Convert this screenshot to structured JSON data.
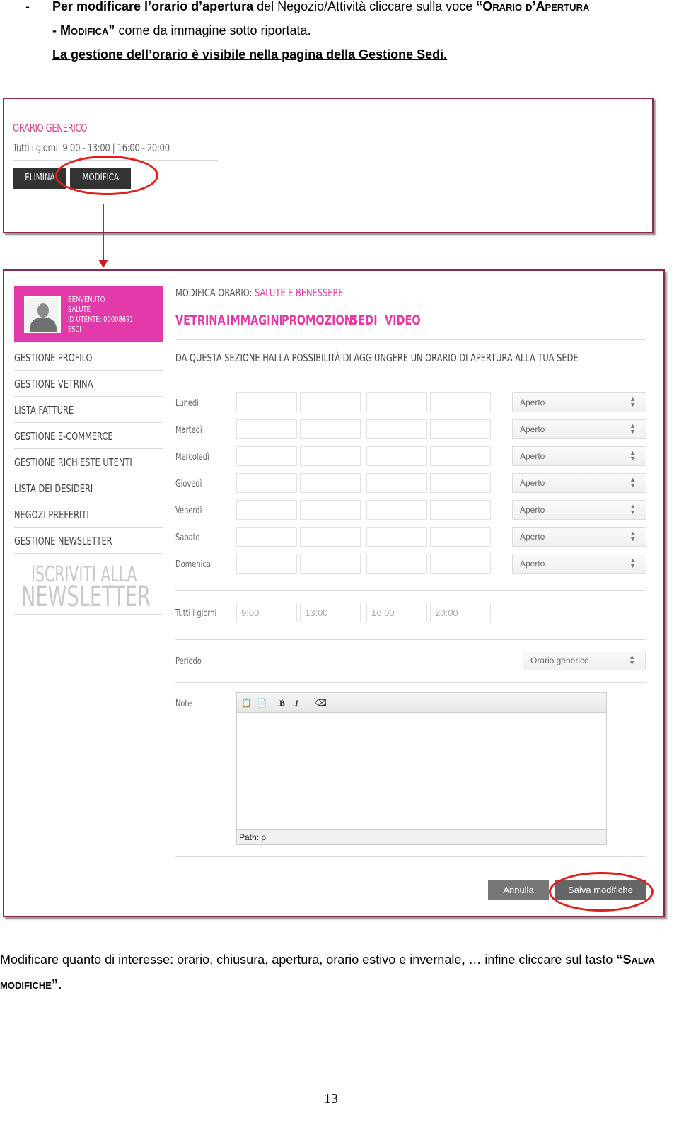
{
  "intro": {
    "dash": "-",
    "line1_bold": "Per modificare l’orario d’apertura",
    "line1_text": " del Negozio/Attività cliccare sulla voce ",
    "line1_smallcaps": "“Orario d’Apertura",
    "line2_smallcaps": "- Modifica”",
    "line2_text": " come da immagine sotto riportata.",
    "line3": "La gestione dell’orario è visibile nella pagina della Gestione Sedi."
  },
  "shot1": {
    "title": "ORARIO GENERICO",
    "hours": "Tutti i giorni: 9:00 - 13:00 | 16:00 - 20:00",
    "elimina": "ELIMINA",
    "modifica": "MODIFICA"
  },
  "shot2": {
    "profile": {
      "welcome": "BENVENUTO",
      "name": "SALUTE",
      "user_id": "ID UTENTE: 00008691",
      "logout": "ESCI"
    },
    "menu": [
      "GESTIONE PROFILO",
      "GESTIONE VETRINA",
      "LISTA FATTURE",
      "GESTIONE E-COMMERCE",
      "GESTIONE RICHIESTE UTENTI",
      "LISTA DEI DESIDERI",
      "NEGOZI PREFERITI",
      "GESTIONE NEWSLETTER"
    ],
    "newsletter_line1": "ISCRIVITI ALLA",
    "newsletter_line2": "NEWSLETTER",
    "title_prefix": "MODIFICA ORARIO: ",
    "title_name": "SALUTE E BENESSERE",
    "tabs": [
      "VETRINA",
      "IMMAGINI",
      "PROMOZIONI",
      "SEDI",
      "VIDEO"
    ],
    "description": "DA QUESTA SEZIONE HAI LA POSSIBILITÀ DI AGGIUNGERE UN ORARIO DI APERTURA ALLA TUA SEDE",
    "days": [
      {
        "label": "Lunedì",
        "status": "Aperto"
      },
      {
        "label": "Martedì",
        "status": "Aperto"
      },
      {
        "label": "Mercoledì",
        "status": "Aperto"
      },
      {
        "label": "Giovedì",
        "status": "Aperto"
      },
      {
        "label": "Venerdì",
        "status": "Aperto"
      },
      {
        "label": "Sabato",
        "status": "Aperto"
      },
      {
        "label": "Domenica",
        "status": "Aperto"
      }
    ],
    "all_days": {
      "label": "Tutti i giorni",
      "times": [
        "9:00",
        "13:00",
        "16:00",
        "20:00"
      ]
    },
    "periodo_label": "Periodo",
    "periodo_value": "Orario generico",
    "note_label": "Note",
    "editor_path": "Path: p",
    "cancel": "Annulla",
    "save": "Salva modifiche"
  },
  "outro": {
    "text1": "Modificare quanto di interesse: orario, chiusura, apertura, orario estivo e invernale",
    "text1_bold": ",",
    "text2": " … infine cliccare sul tasto ",
    "smallcaps": "“Salva modifiche”",
    "end": "."
  },
  "page_number": "13"
}
